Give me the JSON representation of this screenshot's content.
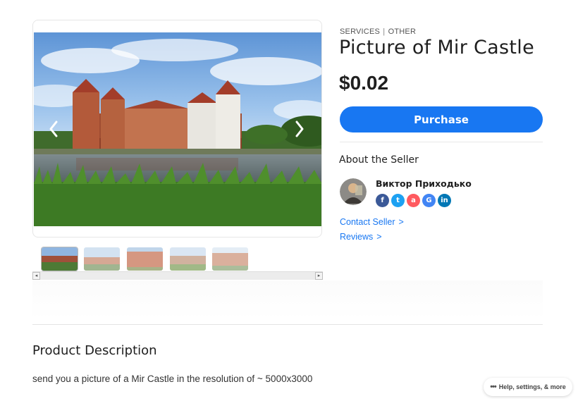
{
  "product": {
    "category": "SERVICES",
    "subcategory": "OTHER",
    "title": "Picture of Mir Castle",
    "price": "$0.02",
    "purchase_label": "Purchase"
  },
  "gallery": {
    "main_image": "Mir Castle photo",
    "thumbnail_count": 5,
    "active_thumbnail": 1
  },
  "seller": {
    "section_title": "About the Seller",
    "name": "Виктор Приходько",
    "social": [
      {
        "icon": "facebook-icon",
        "glyph": "f",
        "color": "#3b5998"
      },
      {
        "icon": "twitter-icon",
        "glyph": "t",
        "color": "#1da1f2"
      },
      {
        "icon": "airbnb-icon",
        "glyph": "a",
        "color": "#ff5a5f"
      },
      {
        "icon": "google-icon",
        "glyph": "G",
        "color": "#4285f4"
      },
      {
        "icon": "linkedin-icon",
        "glyph": "in",
        "color": "#0077b5"
      }
    ],
    "contact_label": "Contact Seller",
    "reviews_label": "Reviews",
    "chevron": ">"
  },
  "description": {
    "heading": "Product Description",
    "text": "send you a picture of a Mir Castle in the resolution of ~ 5000x3000"
  },
  "help": {
    "label": "Help, settings, & more",
    "dots": "•••"
  },
  "colors": {
    "accent": "#1877f2"
  }
}
